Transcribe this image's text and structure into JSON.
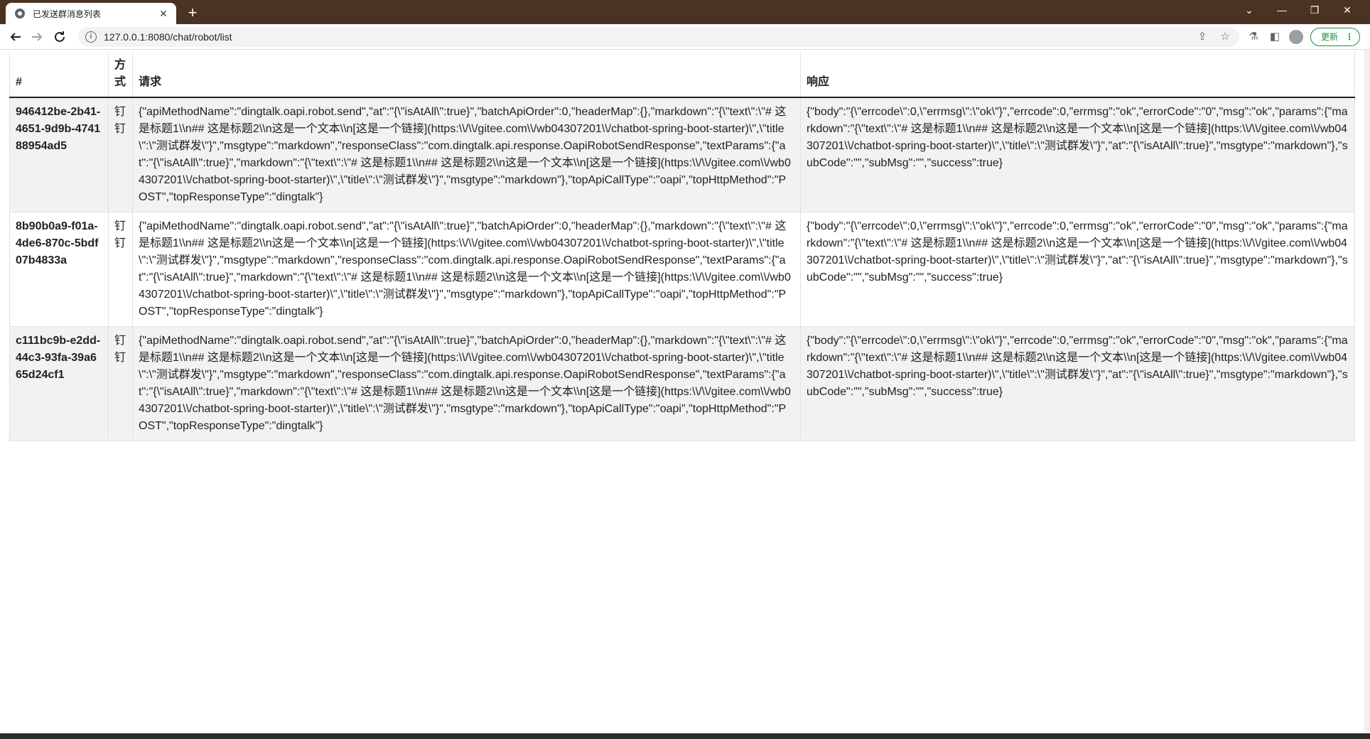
{
  "browser": {
    "tab_title": "已发送群消息列表",
    "tab_close": "✕",
    "new_tab": "+",
    "url": "127.0.0.1:8080/chat/robot/list",
    "update_label": "更新",
    "update_dots": "⋮",
    "window_controls": [
      "⌄",
      "—",
      "❐",
      "✕"
    ]
  },
  "table": {
    "headers": {
      "id": "#",
      "method": "方式",
      "request": "请求",
      "response": "响应"
    },
    "rows": [
      {
        "id": "946412be-2b41-4651-9d9b-474188954ad5",
        "method": "钉钉",
        "request": "{\"apiMethodName\":\"dingtalk.oapi.robot.send\",\"at\":\"{\\\"isAtAll\\\":true}\",\"batchApiOrder\":0,\"headerMap\":{},\"markdown\":\"{\\\"text\\\":\\\"# 这是标题1\\\\n## 这是标题2\\\\n这是一个文本\\\\n[这是一个链接](https:\\\\/\\\\/gitee.com\\\\/wb04307201\\\\/chatbot-spring-boot-starter)\\\",\\\"title\\\":\\\"测试群发\\\"}\",\"msgtype\":\"markdown\",\"responseClass\":\"com.dingtalk.api.response.OapiRobotSendResponse\",\"textParams\":{\"at\":\"{\\\"isAtAll\\\":true}\",\"markdown\":\"{\\\"text\\\":\\\"# 这是标题1\\\\n## 这是标题2\\\\n这是一个文本\\\\n[这是一个链接](https:\\\\/\\\\/gitee.com\\\\/wb04307201\\\\/chatbot-spring-boot-starter)\\\",\\\"title\\\":\\\"测试群发\\\"}\",\"msgtype\":\"markdown\"},\"topApiCallType\":\"oapi\",\"topHttpMethod\":\"POST\",\"topResponseType\":\"dingtalk\"}",
        "response": "{\"body\":\"{\\\"errcode\\\":0,\\\"errmsg\\\":\\\"ok\\\"}\",\"errcode\":0,\"errmsg\":\"ok\",\"errorCode\":\"0\",\"msg\":\"ok\",\"params\":{\"markdown\":\"{\\\"text\\\":\\\"# 这是标题1\\\\n## 这是标题2\\\\n这是一个文本\\\\n[这是一个链接](https:\\\\/\\\\/gitee.com\\\\/wb04307201\\\\/chatbot-spring-boot-starter)\\\",\\\"title\\\":\\\"测试群发\\\"}\",\"at\":\"{\\\"isAtAll\\\":true}\",\"msgtype\":\"markdown\"},\"subCode\":\"\",\"subMsg\":\"\",\"success\":true}"
      },
      {
        "id": "8b90b0a9-f01a-4de6-870c-5bdf07b4833a",
        "method": "钉钉",
        "request": "{\"apiMethodName\":\"dingtalk.oapi.robot.send\",\"at\":\"{\\\"isAtAll\\\":true}\",\"batchApiOrder\":0,\"headerMap\":{},\"markdown\":\"{\\\"text\\\":\\\"# 这是标题1\\\\n## 这是标题2\\\\n这是一个文本\\\\n[这是一个链接](https:\\\\/\\\\/gitee.com\\\\/wb04307201\\\\/chatbot-spring-boot-starter)\\\",\\\"title\\\":\\\"测试群发\\\"}\",\"msgtype\":\"markdown\",\"responseClass\":\"com.dingtalk.api.response.OapiRobotSendResponse\",\"textParams\":{\"at\":\"{\\\"isAtAll\\\":true}\",\"markdown\":\"{\\\"text\\\":\\\"# 这是标题1\\\\n## 这是标题2\\\\n这是一个文本\\\\n[这是一个链接](https:\\\\/\\\\/gitee.com\\\\/wb04307201\\\\/chatbot-spring-boot-starter)\\\",\\\"title\\\":\\\"测试群发\\\"}\",\"msgtype\":\"markdown\"},\"topApiCallType\":\"oapi\",\"topHttpMethod\":\"POST\",\"topResponseType\":\"dingtalk\"}",
        "response": "{\"body\":\"{\\\"errcode\\\":0,\\\"errmsg\\\":\\\"ok\\\"}\",\"errcode\":0,\"errmsg\":\"ok\",\"errorCode\":\"0\",\"msg\":\"ok\",\"params\":{\"markdown\":\"{\\\"text\\\":\\\"# 这是标题1\\\\n## 这是标题2\\\\n这是一个文本\\\\n[这是一个链接](https:\\\\/\\\\/gitee.com\\\\/wb04307201\\\\/chatbot-spring-boot-starter)\\\",\\\"title\\\":\\\"测试群发\\\"}\",\"at\":\"{\\\"isAtAll\\\":true}\",\"msgtype\":\"markdown\"},\"subCode\":\"\",\"subMsg\":\"\",\"success\":true}"
      },
      {
        "id": "c111bc9b-e2dd-44c3-93fa-39a665d24cf1",
        "method": "钉钉",
        "request": "{\"apiMethodName\":\"dingtalk.oapi.robot.send\",\"at\":\"{\\\"isAtAll\\\":true}\",\"batchApiOrder\":0,\"headerMap\":{},\"markdown\":\"{\\\"text\\\":\\\"# 这是标题1\\\\n## 这是标题2\\\\n这是一个文本\\\\n[这是一个链接](https:\\\\/\\\\/gitee.com\\\\/wb04307201\\\\/chatbot-spring-boot-starter)\\\",\\\"title\\\":\\\"测试群发\\\"}\",\"msgtype\":\"markdown\",\"responseClass\":\"com.dingtalk.api.response.OapiRobotSendResponse\",\"textParams\":{\"at\":\"{\\\"isAtAll\\\":true}\",\"markdown\":\"{\\\"text\\\":\\\"# 这是标题1\\\\n## 这是标题2\\\\n这是一个文本\\\\n[这是一个链接](https:\\\\/\\\\/gitee.com\\\\/wb04307201\\\\/chatbot-spring-boot-starter)\\\",\\\"title\\\":\\\"测试群发\\\"}\",\"msgtype\":\"markdown\"},\"topApiCallType\":\"oapi\",\"topHttpMethod\":\"POST\",\"topResponseType\":\"dingtalk\"}",
        "response": "{\"body\":\"{\\\"errcode\\\":0,\\\"errmsg\\\":\\\"ok\\\"}\",\"errcode\":0,\"errmsg\":\"ok\",\"errorCode\":\"0\",\"msg\":\"ok\",\"params\":{\"markdown\":\"{\\\"text\\\":\\\"# 这是标题1\\\\n## 这是标题2\\\\n这是一个文本\\\\n[这是一个链接](https:\\\\/\\\\/gitee.com\\\\/wb04307201\\\\/chatbot-spring-boot-starter)\\\",\\\"title\\\":\\\"测试群发\\\"}\",\"at\":\"{\\\"isAtAll\\\":true}\",\"msgtype\":\"markdown\"},\"subCode\":\"\",\"subMsg\":\"\",\"success\":true}"
      }
    ]
  }
}
